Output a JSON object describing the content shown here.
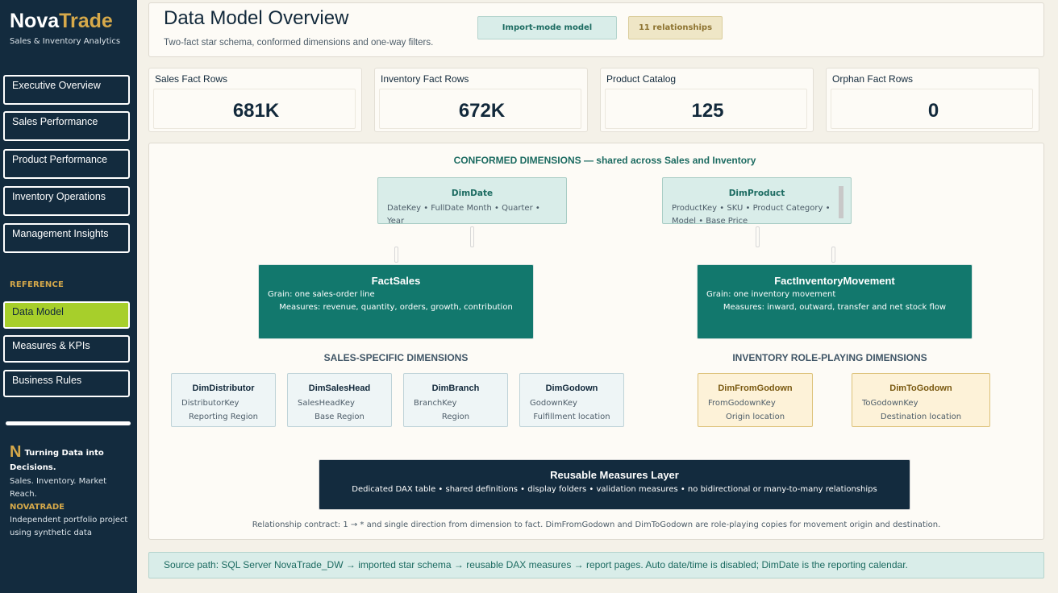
{
  "sidebar": {
    "brand_main": "Nova",
    "brand_accent": "Trade",
    "subtitle": "Sales & Inventory Analytics",
    "nav": [
      {
        "label": "Executive Overview"
      },
      {
        "label": "Sales Performance"
      },
      {
        "label": "Product Performance"
      },
      {
        "label": "Inventory Operations"
      },
      {
        "label": "Management Insights"
      }
    ],
    "reference_label": "REFERENCE",
    "reference_nav": [
      {
        "label": "Data Model",
        "active": true
      },
      {
        "label": "Measures & KPIs"
      },
      {
        "label": "Business Rules"
      }
    ],
    "footer": {
      "logo_letter": "N",
      "tagline_1": "Turning Data into",
      "tagline_2": "Decisions.",
      "line1": "Sales. Inventory. Market Reach.",
      "brand": "NOVATRADE",
      "line2": "Independent portfolio project",
      "line3": "using synthetic data"
    }
  },
  "header": {
    "title": "Data Model Overview",
    "subtitle": "Two-fact star schema, conformed dimensions and one-way filters.",
    "badges": {
      "import": "Import-mode model",
      "relationships": "11 relationships"
    }
  },
  "kpis": [
    {
      "label": "Sales Fact Rows",
      "value": "681K"
    },
    {
      "label": "Inventory Fact Rows",
      "value": "672K"
    },
    {
      "label": "Product Catalog",
      "value": "125"
    },
    {
      "label": "Orphan Fact Rows",
      "value": "0"
    }
  ],
  "model": {
    "conformed_heading": "CONFORMED DIMENSIONS — shared across Sales and Inventory",
    "dim_date": {
      "name": "DimDate",
      "desc": "DateKey • FullDate Month • Quarter • Year"
    },
    "dim_product": {
      "name": "DimProduct",
      "desc": "ProductKey • SKU • Product Category • Model • Base Price"
    },
    "fact_sales": {
      "name": "FactSales",
      "grain": "Grain: one sales-order line",
      "measures": "Measures: revenue, quantity, orders, growth, contribution"
    },
    "fact_inventory": {
      "name": "FactInventoryMovement",
      "grain": "Grain: one inventory movement",
      "measures": "Measures: inward, outward, transfer and net stock flow"
    },
    "sales_heading": "SALES-SPECIFIC DIMENSIONS",
    "inventory_heading": "INVENTORY ROLE-PLAYING DIMENSIONS",
    "sales_dims": [
      {
        "name": "DimDistributor",
        "key": "DistributorKey",
        "role": "Reporting Region"
      },
      {
        "name": "DimSalesHead",
        "key": "SalesHeadKey",
        "role": "Base Region"
      },
      {
        "name": "DimBranch",
        "key": "BranchKey",
        "role": "Region"
      },
      {
        "name": "DimGodown",
        "key": "GodownKey",
        "role": "Fulfillment location"
      }
    ],
    "inventory_dims": [
      {
        "name": "DimFromGodown",
        "key": "FromGodownKey",
        "role": "Origin location"
      },
      {
        "name": "DimToGodown",
        "key": "ToGodownKey",
        "role": "Destination location"
      }
    ],
    "measures_layer": {
      "name": "Reusable Measures Layer",
      "desc": "Dedicated DAX table • shared definitions • display folders • validation measures • no bidirectional or many-to-many relationships"
    },
    "contract": "Relationship contract: 1 → * and single direction from dimension to fact. DimFromGodown and DimToGodown are role-playing copies for movement origin and destination."
  },
  "source": "Source path: SQL Server NovaTrade_DW → imported star schema → reusable DAX measures → report pages. Auto date/time is disabled; DimDate is the reporting calendar.",
  "colors": {
    "navy": "#132b3e",
    "teal": "#12786d",
    "lime": "#a7cf2b",
    "gold": "#d6a94a"
  }
}
